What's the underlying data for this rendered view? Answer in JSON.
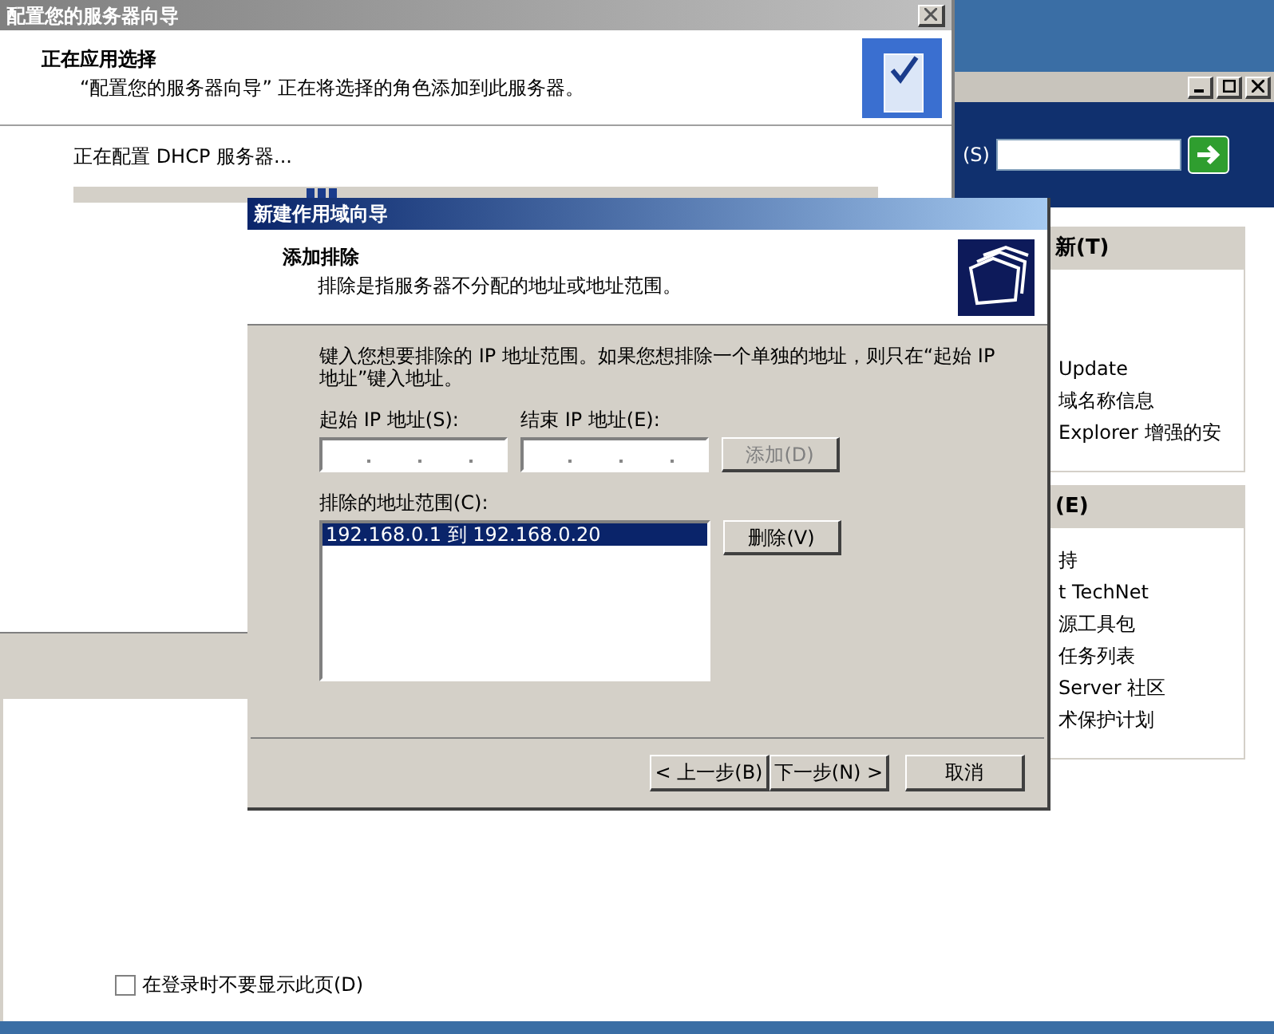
{
  "manage_server_window": {
    "search_label": "(S)",
    "panels": [
      {
        "header": "新(T)",
        "items": [
          "Update",
          "域名称信息",
          "Explorer 增强的安"
        ]
      },
      {
        "header": "(E)",
        "items": [
          "持",
          "t TechNet",
          "源工具包",
          "任务列表",
          "Server 社区",
          "术保护计划"
        ]
      }
    ],
    "dont_show_checkbox": {
      "label": "在登录时不要显示此页(D)",
      "checked": false
    }
  },
  "configure_wizard": {
    "title": "配置您的服务器向导",
    "heading": "正在应用选择",
    "subheading": "“配置您的服务器向导” 正在将选择的角色添加到此服务器。",
    "status": "正在配置 DHCP 服务器...",
    "progress": {
      "level": 0.33
    }
  },
  "scope_wizard": {
    "title": "新建作用域向导",
    "heading": "添加排除",
    "subheading": "排除是指服务器不分配的地址或地址范围。",
    "instructions": "键入您想要排除的 IP 地址范围。如果您想排除一个单独的地址，则只在“起始 IP 地址”键入地址。",
    "start_ip": {
      "label": "起始 IP 地址(S):"
    },
    "end_ip": {
      "label": "结束 IP 地址(E):"
    },
    "add_button": {
      "label": "添加(D)",
      "disabled": true
    },
    "excluded_label": "排除的地址范围(C):",
    "excluded_ranges": [
      {
        "text": "192.168.0.1 到 192.168.0.20",
        "selected": true
      }
    ],
    "remove_button": {
      "label": "删除(V)",
      "disabled": false
    },
    "buttons": [
      {
        "label": "< 上一步(B)"
      },
      {
        "label": "下一步(N) >"
      },
      {
        "label": "取消"
      }
    ]
  }
}
